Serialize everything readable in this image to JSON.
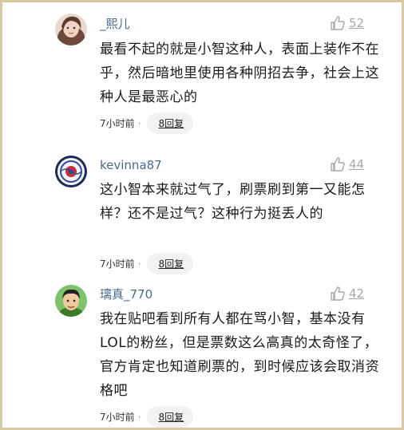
{
  "comments": [
    {
      "username": "_熙儿",
      "likes": "52",
      "text": "最看不起的就是小智这种人，表面上装作不在乎，然后暗地里使用各种阴招去争，社会上这种人是最恶心的",
      "time": "7小时前",
      "replies": "8回复",
      "avatar_icon": "user-avatar-woman"
    },
    {
      "username": "kevinna87",
      "likes": "44",
      "text": "这小智本来就过气了，刷票刷到第一又能怎样？还不是过气？这种行为挺丢人的",
      "time": "7小时前",
      "replies": "8回复",
      "avatar_icon": "user-avatar-porcelain"
    },
    {
      "username": "璃真_770",
      "likes": "42",
      "text": "我在贴吧看到所有人都在骂小智，基本没有LOL的粉丝，但是票数这么高真的太奇怪了，官方肯定也知道刷票的，到时候应该会取消资格吧",
      "time": "7小时前",
      "replies": "8回复",
      "avatar_icon": "user-avatar-boy"
    }
  ],
  "colors": {
    "username": "#4a6a8c",
    "like": "#a9a9a9",
    "frame": "#d8c9a3"
  }
}
